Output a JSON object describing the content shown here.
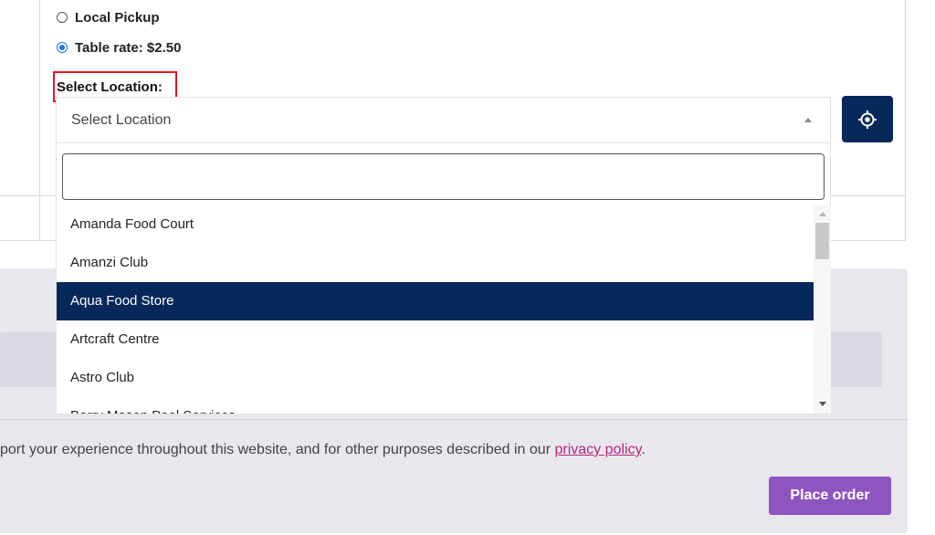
{
  "shipping": {
    "options": [
      {
        "label": "Local Pickup",
        "selected": false
      },
      {
        "label": "Table rate: $2.50",
        "selected": true
      }
    ]
  },
  "location": {
    "label": "Select Location:",
    "selected_value": "Select Location",
    "search_value": "",
    "options": [
      "Amanda Food Court",
      "Amanzi Club",
      "Aqua Food Store",
      "Artcraft Centre",
      "Astro Club",
      "Barry Mason Pool Services"
    ],
    "highlighted_index": 2,
    "locate_icon": "crosshair-icon"
  },
  "privacy": {
    "text_before": "port your experience throughout this website, and for other purposes described in our ",
    "link_text": "privacy policy",
    "text_after": "."
  },
  "place_order_label": "Place order",
  "colors": {
    "primary_navy": "#06285a",
    "highlight_box": "#e8151b",
    "place_order": "#8e55c0",
    "link": "#b02a7a",
    "panel_bg": "#e9e6ee"
  }
}
